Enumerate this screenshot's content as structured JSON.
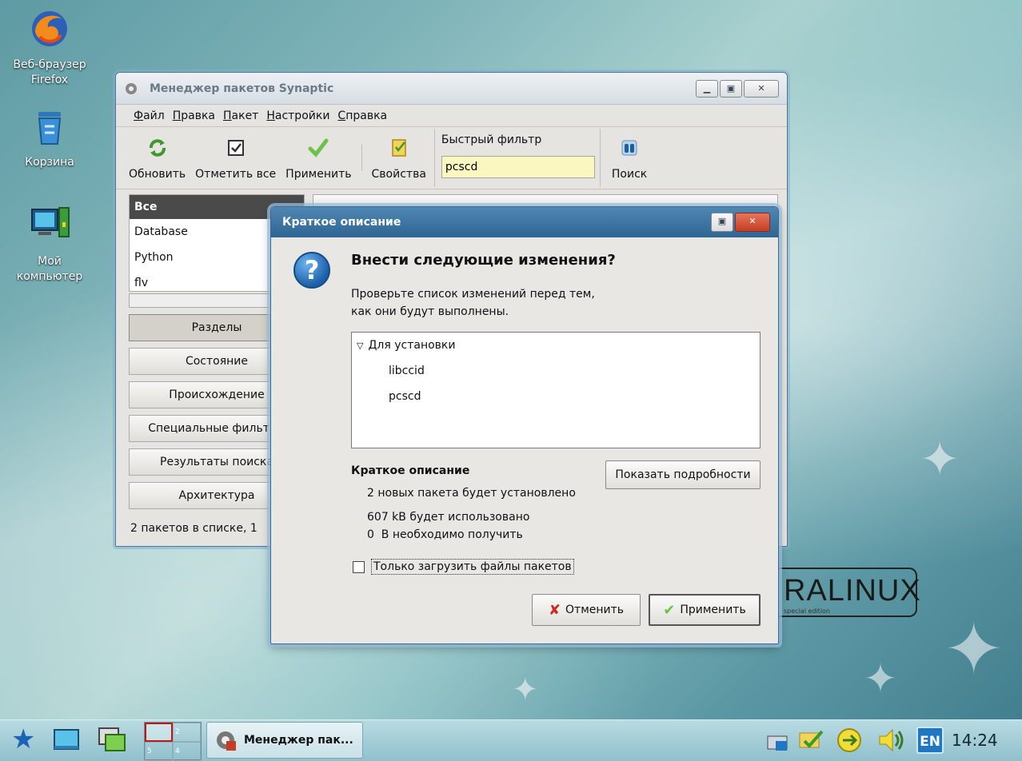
{
  "desktop": {
    "icons": [
      {
        "label": "Веб-браузер Firefox"
      },
      {
        "label": "Корзина"
      },
      {
        "label": "Мой компьютер"
      }
    ],
    "brand": {
      "text": "RALINUX",
      "subtitle": "special edition"
    }
  },
  "synaptic": {
    "title": "Менеджер пакетов Synaptic",
    "menu": [
      "Файл",
      "Правка",
      "Пакет",
      "Настройки",
      "Справка"
    ],
    "toolbar": {
      "reload": "Обновить",
      "mark_all": "Отметить все",
      "apply": "Применить",
      "properties": "Свойства",
      "quick_filter_label": "Быстрый фильтр",
      "quick_filter_value": "pcscd",
      "search": "Поиск"
    },
    "categories": [
      "Все",
      "Database",
      "Python",
      "flv"
    ],
    "side_buttons": [
      "Разделы",
      "Состояние",
      "Происхождение",
      "Специальные фильтры",
      "Результаты поиска",
      "Архитектура"
    ],
    "status": "2 пакетов в списке, 1"
  },
  "dialog": {
    "title": "Краткое описание",
    "heading": "Внести следующие изменения?",
    "description": "Проверьте список изменений перед тем, как они будут выполнены.",
    "group": "Для установки",
    "packages": [
      "libccid",
      "pcscd"
    ],
    "summary_title": "Краткое описание",
    "summary_lines": [
      "2 новых пакета будет установлено",
      "607 kB будет использовано",
      "0  B необходимо получить"
    ],
    "details_button": "Показать подробности",
    "download_only": "Только загрузить файлы пакетов",
    "cancel": "Отменить",
    "apply": "Применить"
  },
  "taskbar": {
    "workspaces": [
      "",
      "2",
      "5",
      "4"
    ],
    "task_label": "Менеджер пак...",
    "lang": "EN",
    "clock": "14:24"
  }
}
